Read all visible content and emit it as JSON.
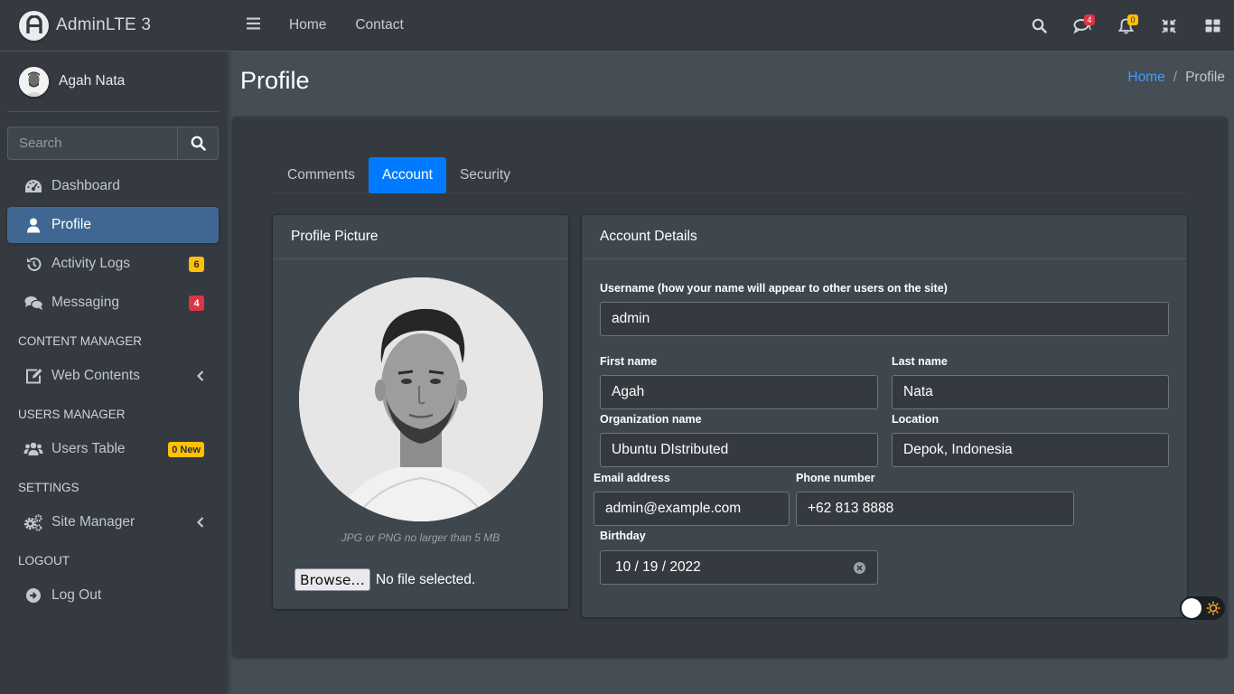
{
  "brand": {
    "name": "AdminLTE 3"
  },
  "user": {
    "name": "Agah Nata"
  },
  "sidebar_search": {
    "placeholder": "Search"
  },
  "nav": {
    "dashboard": "Dashboard",
    "profile": "Profile",
    "activity_logs": "Activity Logs",
    "activity_logs_badge": "6",
    "messaging": "Messaging",
    "messaging_badge": "4",
    "content_manager_header": "CONTENT MANAGER",
    "web_contents": "Web Contents",
    "users_manager_header": "USERS MANAGER",
    "users_table": "Users Table",
    "users_table_badge": "0 New",
    "settings_header": "SETTINGS",
    "site_manager": "Site Manager",
    "logout_header": "LOGOUT",
    "log_out": "Log Out"
  },
  "topbar": {
    "links": [
      "Home",
      "Contact"
    ],
    "messages_badge": "4",
    "notifications_badge": "0"
  },
  "page": {
    "title": "Profile",
    "breadcrumb": [
      "Home",
      "Profile"
    ]
  },
  "tabs": [
    "Comments",
    "Account",
    "Security"
  ],
  "profile_picture": {
    "title": "Profile Picture",
    "hint": "JPG or PNG no larger than 5 MB",
    "browse_label": "Browse…",
    "file_status": "No file selected."
  },
  "account": {
    "title": "Account Details",
    "username_label": "Username (how your name will appear to other users on the site)",
    "username": "admin",
    "first_name_label": "First name",
    "first_name": "Agah",
    "last_name_label": "Last name",
    "last_name": "Nata",
    "org_label": "Organization name",
    "org": "Ubuntu DIstributed",
    "location_label": "Location",
    "location": "Depok, Indonesia",
    "email_label": "Email address",
    "email": "admin@example.com",
    "phone_label": "Phone number",
    "phone": "+62 813 8888",
    "birthday_label": "Birthday",
    "birthday": "10 / 19 / 2022"
  },
  "colors": {
    "sidebar_bg": "#343a40",
    "content_bg": "#454d55",
    "active_nav": "#3f6791",
    "primary": "#007bff",
    "warning": "#ffc107",
    "danger": "#dc3545"
  },
  "icons": [
    "adminlte-logo-icon",
    "search-icon",
    "dashboard-icon",
    "user-icon",
    "history-icon",
    "comments-icon",
    "edit-icon",
    "users-icon",
    "cogs-icon",
    "sign-out-icon",
    "chevron-left-icon",
    "bars-icon",
    "message-icon",
    "bell-icon",
    "compress-icon",
    "grid-icon",
    "clear-icon",
    "sun-icon"
  ]
}
